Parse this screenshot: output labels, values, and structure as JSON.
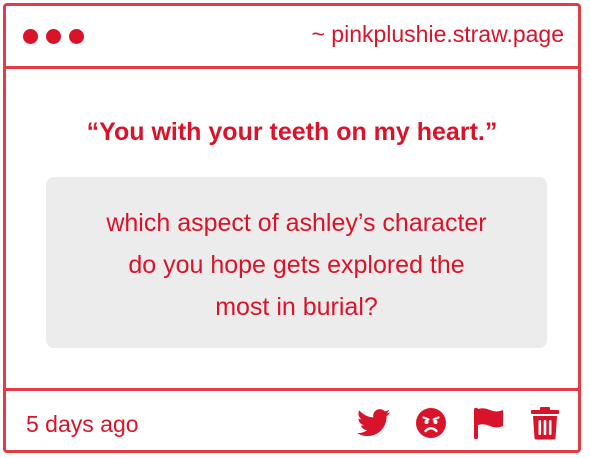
{
  "header": {
    "site_label": "~ pinkplushie.straw.page"
  },
  "card": {
    "quote": "“You with your teeth on my heart.”",
    "question_lines": [
      "which aspect of ashley’s character",
      "do you hope gets explored the",
      "most in burial?"
    ]
  },
  "footer": {
    "timestamp": "5 days ago",
    "actions": [
      "twitter-icon",
      "angry-face-icon",
      "flag-icon",
      "trash-icon"
    ]
  },
  "colors": {
    "accent": "#d9142a",
    "border": "#e23a47",
    "question_bg": "#ececec"
  }
}
